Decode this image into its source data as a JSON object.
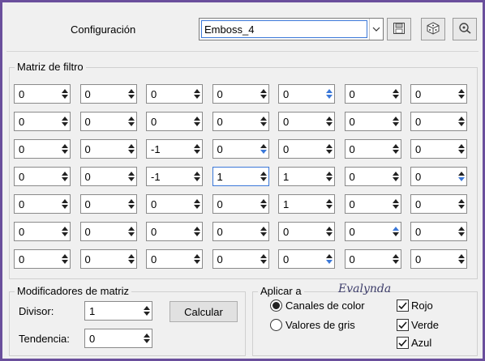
{
  "header": {
    "config_label": "Configuración",
    "preset_value": "Emboss_4"
  },
  "icons": {
    "save": "save-icon",
    "random": "dice-icon",
    "reset": "reset-icon"
  },
  "matrix": {
    "title": "Matriz de filtro",
    "rows": [
      [
        "0",
        "0",
        "0",
        "0",
        "0",
        "0",
        "0"
      ],
      [
        "0",
        "0",
        "0",
        "0",
        "0",
        "0",
        "0"
      ],
      [
        "0",
        "0",
        "-1",
        "0",
        "0",
        "0",
        "0"
      ],
      [
        "0",
        "0",
        "-1",
        "1",
        "1",
        "0",
        "0"
      ],
      [
        "0",
        "0",
        "0",
        "0",
        "1",
        "0",
        "0"
      ],
      [
        "0",
        "0",
        "0",
        "0",
        "0",
        "0",
        "0"
      ],
      [
        "0",
        "0",
        "0",
        "0",
        "0",
        "0",
        "0"
      ]
    ]
  },
  "modifiers": {
    "title": "Modificadores de matriz",
    "divisor_label": "Divisor:",
    "divisor_value": "1",
    "bias_label": "Tendencia:",
    "bias_value": "0",
    "calc_label": "Calcular"
  },
  "apply": {
    "title": "Aplicar a",
    "radio_color": "Canales de color",
    "radio_gray": "Valores de gris",
    "selected": "color",
    "check_red": "Rojo",
    "check_green": "Verde",
    "check_blue": "Azul",
    "red_checked": true,
    "green_checked": true,
    "blue_checked": true
  },
  "watermark": "Evalynda",
  "colors": {
    "frame": "#6a4f9c",
    "focus": "#3b78d8"
  }
}
